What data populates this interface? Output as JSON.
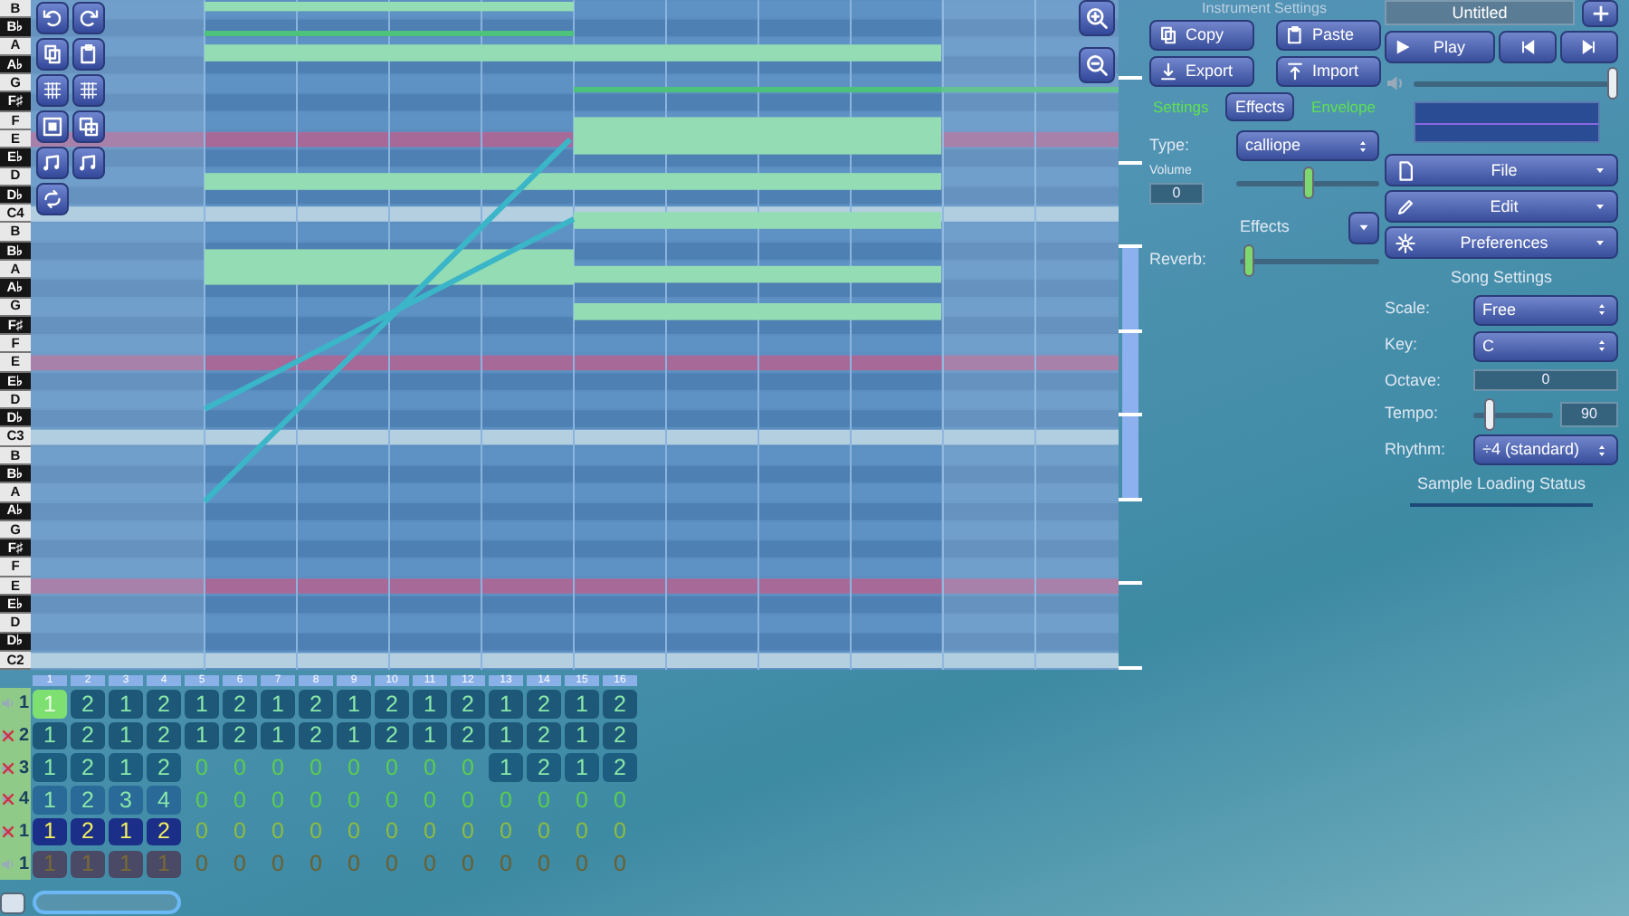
{
  "piano_roll": {
    "keys": [
      {
        "label": "B",
        "kind": "white"
      },
      {
        "label": "B♭",
        "kind": "black"
      },
      {
        "label": "A",
        "kind": "white"
      },
      {
        "label": "A♭",
        "kind": "black"
      },
      {
        "label": "G",
        "kind": "white"
      },
      {
        "label": "F♯",
        "kind": "black"
      },
      {
        "label": "F",
        "kind": "white"
      },
      {
        "label": "E",
        "kind": "white"
      },
      {
        "label": "E♭",
        "kind": "black"
      },
      {
        "label": "D",
        "kind": "white"
      },
      {
        "label": "D♭",
        "kind": "black"
      },
      {
        "label": "C4",
        "kind": "white"
      },
      {
        "label": "B",
        "kind": "white"
      },
      {
        "label": "B♭",
        "kind": "black"
      },
      {
        "label": "A",
        "kind": "white"
      },
      {
        "label": "A♭",
        "kind": "black"
      },
      {
        "label": "G",
        "kind": "white"
      },
      {
        "label": "F♯",
        "kind": "black"
      },
      {
        "label": "F",
        "kind": "white"
      },
      {
        "label": "E",
        "kind": "white"
      },
      {
        "label": "E♭",
        "kind": "black"
      },
      {
        "label": "D",
        "kind": "white"
      },
      {
        "label": "D♭",
        "kind": "black"
      },
      {
        "label": "C3",
        "kind": "white"
      },
      {
        "label": "B",
        "kind": "white"
      },
      {
        "label": "B♭",
        "kind": "black"
      },
      {
        "label": "A",
        "kind": "white"
      },
      {
        "label": "A♭",
        "kind": "black"
      },
      {
        "label": "G",
        "kind": "white"
      },
      {
        "label": "F♯",
        "kind": "black"
      },
      {
        "label": "F",
        "kind": "white"
      },
      {
        "label": "E",
        "kind": "white"
      },
      {
        "label": "E♭",
        "kind": "black"
      },
      {
        "label": "D",
        "kind": "white"
      },
      {
        "label": "D♭",
        "kind": "black"
      },
      {
        "label": "C2",
        "kind": "white"
      }
    ]
  },
  "instrument_settings": {
    "title": "Instrument Settings",
    "buttons": [
      {
        "label": "Copy"
      },
      {
        "label": "Paste"
      },
      {
        "label": "Export"
      },
      {
        "label": "Import"
      }
    ],
    "tabs": [
      {
        "label": "Settings",
        "selected": false
      },
      {
        "label": "Effects",
        "selected": true
      },
      {
        "label": "Envelope",
        "selected": false
      }
    ],
    "type": {
      "label": "Type:",
      "value": "calliope"
    },
    "volume": {
      "label": "Volume",
      "value": "0",
      "level": 0.5
    },
    "effects": {
      "label": "Effects"
    },
    "reverb": {
      "label": "Reverb:",
      "level": 0.03
    }
  },
  "song": {
    "title": "Untitled",
    "play": {
      "label": "Play"
    },
    "volume": {
      "level": 1
    },
    "menus": [
      {
        "label": "File"
      },
      {
        "label": "Edit"
      },
      {
        "label": "Preferences"
      }
    ],
    "settings_title": "Song Settings",
    "scale": {
      "label": "Scale:",
      "value": "Free"
    },
    "key": {
      "label": "Key:",
      "value": "C"
    },
    "octave": {
      "label": "Octave:",
      "value": "0"
    },
    "tempo": {
      "label": "Tempo:",
      "value": "90",
      "level": 0.15
    },
    "rhythm": {
      "label": "Rhythm:",
      "value": "÷4 (standard)"
    },
    "loading_status": "Sample Loading Status"
  },
  "pattern_editor": {
    "bar_numbers": [
      "1",
      "2",
      "3",
      "4",
      "5",
      "6",
      "7",
      "8",
      "9",
      "10",
      "11",
      "12",
      "13",
      "14",
      "15",
      "16"
    ],
    "channels": [
      {
        "number": "1",
        "kind": "pitch",
        "muted": false,
        "color": "#1d5878",
        "cells": [
          {
            "text": "1",
            "filled": true,
            "selected": true
          },
          {
            "text": "2",
            "filled": true,
            "selected": false
          },
          {
            "text": "1",
            "filled": true,
            "selected": false
          },
          {
            "text": "2",
            "filled": true,
            "selected": false
          },
          {
            "text": "1",
            "filled": true,
            "selected": false
          },
          {
            "text": "2",
            "filled": true,
            "selected": false
          },
          {
            "text": "1",
            "filled": true,
            "selected": false
          },
          {
            "text": "2",
            "filled": true,
            "selected": false
          },
          {
            "text": "1",
            "filled": true,
            "selected": false
          },
          {
            "text": "2",
            "filled": true,
            "selected": false
          },
          {
            "text": "1",
            "filled": true,
            "selected": false
          },
          {
            "text": "2",
            "filled": true,
            "selected": false
          },
          {
            "text": "1",
            "filled": true,
            "selected": false
          },
          {
            "text": "2",
            "filled": true,
            "selected": false
          },
          {
            "text": "1",
            "filled": true,
            "selected": false
          },
          {
            "text": "2",
            "filled": true,
            "selected": false
          }
        ]
      },
      {
        "number": "2",
        "kind": "pitch",
        "muted": true,
        "color": "#1d5878",
        "cells": [
          {
            "text": "1",
            "filled": true,
            "selected": false
          },
          {
            "text": "2",
            "filled": true,
            "selected": false
          },
          {
            "text": "1",
            "filled": true,
            "selected": false
          },
          {
            "text": "2",
            "filled": true,
            "selected": false
          },
          {
            "text": "1",
            "filled": true,
            "selected": false
          },
          {
            "text": "2",
            "filled": true,
            "selected": false
          },
          {
            "text": "1",
            "filled": true,
            "selected": false
          },
          {
            "text": "2",
            "filled": true,
            "selected": false
          },
          {
            "text": "1",
            "filled": true,
            "selected": false
          },
          {
            "text": "2",
            "filled": true,
            "selected": false
          },
          {
            "text": "1",
            "filled": true,
            "selected": false
          },
          {
            "text": "2",
            "filled": true,
            "selected": false
          },
          {
            "text": "1",
            "filled": true,
            "selected": false
          },
          {
            "text": "2",
            "filled": true,
            "selected": false
          },
          {
            "text": "1",
            "filled": true,
            "selected": false
          },
          {
            "text": "2",
            "filled": true,
            "selected": false
          }
        ]
      },
      {
        "number": "3",
        "kind": "pitch",
        "muted": true,
        "color": "#1d5e80",
        "cells": [
          {
            "text": "1",
            "filled": true,
            "selected": false
          },
          {
            "text": "2",
            "filled": true,
            "selected": false
          },
          {
            "text": "1",
            "filled": true,
            "selected": false
          },
          {
            "text": "2",
            "filled": true,
            "selected": false
          },
          {
            "text": "0",
            "filled": false,
            "selected": false
          },
          {
            "text": "0",
            "filled": false,
            "selected": false
          },
          {
            "text": "0",
            "filled": false,
            "selected": false
          },
          {
            "text": "0",
            "filled": false,
            "selected": false
          },
          {
            "text": "0",
            "filled": false,
            "selected": false
          },
          {
            "text": "0",
            "filled": false,
            "selected": false
          },
          {
            "text": "0",
            "filled": false,
            "selected": false
          },
          {
            "text": "0",
            "filled": false,
            "selected": false
          },
          {
            "text": "1",
            "filled": true,
            "selected": false
          },
          {
            "text": "2",
            "filled": true,
            "selected": false
          },
          {
            "text": "1",
            "filled": true,
            "selected": false
          },
          {
            "text": "2",
            "filled": true,
            "selected": false
          }
        ]
      },
      {
        "number": "4",
        "kind": "pitch",
        "muted": true,
        "color": "#2a6a98",
        "cells": [
          {
            "text": "1",
            "filled": true,
            "selected": false
          },
          {
            "text": "2",
            "filled": true,
            "selected": false
          },
          {
            "text": "3",
            "filled": true,
            "selected": false
          },
          {
            "text": "4",
            "filled": true,
            "selected": false
          },
          {
            "text": "0",
            "filled": false,
            "selected": false
          },
          {
            "text": "0",
            "filled": false,
            "selected": false
          },
          {
            "text": "0",
            "filled": false,
            "selected": false
          },
          {
            "text": "0",
            "filled": false,
            "selected": false
          },
          {
            "text": "0",
            "filled": false,
            "selected": false
          },
          {
            "text": "0",
            "filled": false,
            "selected": false
          },
          {
            "text": "0",
            "filled": false,
            "selected": false
          },
          {
            "text": "0",
            "filled": false,
            "selected": false
          },
          {
            "text": "0",
            "filled": false,
            "selected": false
          },
          {
            "text": "0",
            "filled": false,
            "selected": false
          },
          {
            "text": "0",
            "filled": false,
            "selected": false
          },
          {
            "text": "0",
            "filled": false,
            "selected": false
          }
        ]
      },
      {
        "number": "1",
        "kind": "noise",
        "muted": true,
        "color": "#1c2f88",
        "cells": [
          {
            "text": "1",
            "filled": true,
            "selected": false
          },
          {
            "text": "2",
            "filled": true,
            "selected": false
          },
          {
            "text": "1",
            "filled": true,
            "selected": false
          },
          {
            "text": "2",
            "filled": true,
            "selected": false
          },
          {
            "text": "0",
            "filled": false,
            "selected": false
          },
          {
            "text": "0",
            "filled": false,
            "selected": false
          },
          {
            "text": "0",
            "filled": false,
            "selected": false
          },
          {
            "text": "0",
            "filled": false,
            "selected": false
          },
          {
            "text": "0",
            "filled": false,
            "selected": false
          },
          {
            "text": "0",
            "filled": false,
            "selected": false
          },
          {
            "text": "0",
            "filled": false,
            "selected": false
          },
          {
            "text": "0",
            "filled": false,
            "selected": false
          },
          {
            "text": "0",
            "filled": false,
            "selected": false
          },
          {
            "text": "0",
            "filled": false,
            "selected": false
          },
          {
            "text": "0",
            "filled": false,
            "selected": false
          },
          {
            "text": "0",
            "filled": false,
            "selected": false
          }
        ]
      },
      {
        "number": "1",
        "kind": "mod",
        "muted": false,
        "color": "#4a4a66",
        "cells": [
          {
            "text": "1",
            "filled": true,
            "selected": false
          },
          {
            "text": "1",
            "filled": true,
            "selected": false
          },
          {
            "text": "1",
            "filled": true,
            "selected": false
          },
          {
            "text": "1",
            "filled": true,
            "selected": false
          },
          {
            "text": "0",
            "filled": false,
            "selected": false
          },
          {
            "text": "0",
            "filled": false,
            "selected": false
          },
          {
            "text": "0",
            "filled": false,
            "selected": false
          },
          {
            "text": "0",
            "filled": false,
            "selected": false
          },
          {
            "text": "0",
            "filled": false,
            "selected": false
          },
          {
            "text": "0",
            "filled": false,
            "selected": false
          },
          {
            "text": "0",
            "filled": false,
            "selected": false
          },
          {
            "text": "0",
            "filled": false,
            "selected": false
          },
          {
            "text": "0",
            "filled": false,
            "selected": false
          },
          {
            "text": "0",
            "filled": false,
            "selected": false
          },
          {
            "text": "0",
            "filled": false,
            "selected": false
          },
          {
            "text": "0",
            "filled": false,
            "selected": false
          }
        ]
      }
    ]
  }
}
